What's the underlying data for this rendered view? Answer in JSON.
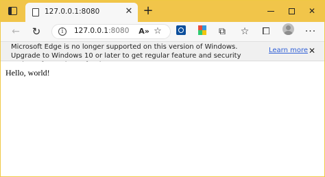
{
  "tab": {
    "title": "127.0.0.1:8080",
    "close_glyph": "✕"
  },
  "tabbar": {
    "new_tab_glyph": "+",
    "close_glyph": "✕"
  },
  "toolbar": {
    "back_glyph": "←",
    "refresh_glyph": "↻",
    "url_host": "127.0.0.1",
    "url_port": ":8080",
    "info_glyph": "i",
    "read_aloud_glyph": "A»",
    "favorite_glyph": "☆",
    "puzzle_glyph": "⧉",
    "favorites_glyph": "☆",
    "collections_glyph": "⧠",
    "more_glyph": "···"
  },
  "notice": {
    "text": "Microsoft Edge is no longer supported on this version of Windows. Upgrade to Windows 10 or later to get regular feature and security updates from Microsoft Edge.",
    "link": "Learn more",
    "close_glyph": "✕"
  },
  "content": {
    "text": "Hello, world!"
  },
  "colors": {
    "frame": "#f0c844",
    "tabbar": "#f1c54a",
    "link": "#2f5fd6"
  }
}
